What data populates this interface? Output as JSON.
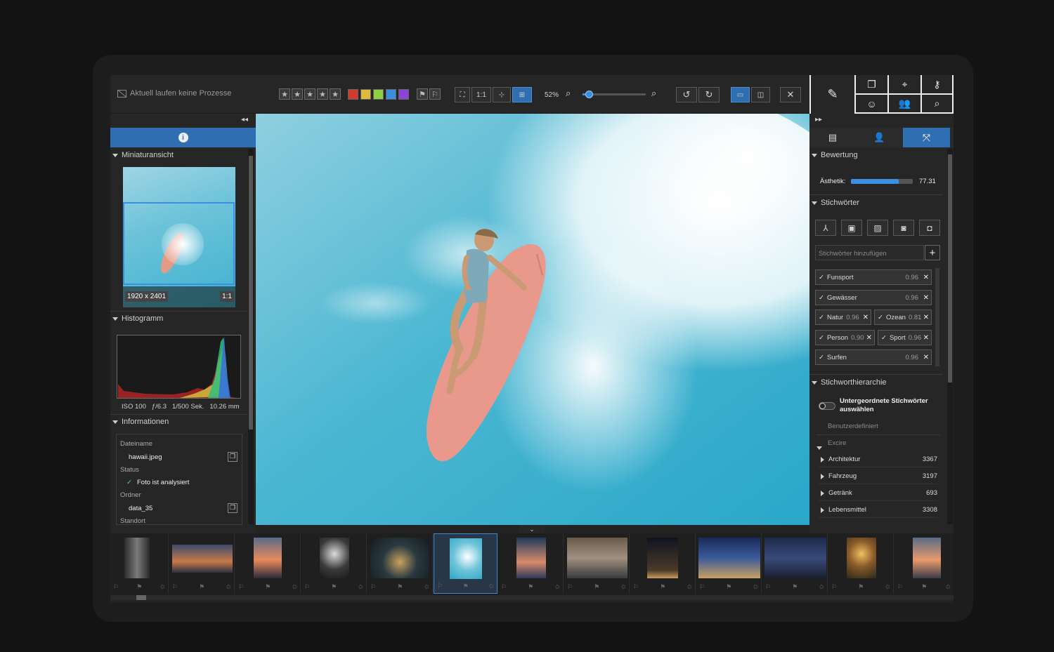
{
  "toolbar": {
    "status_text": "Aktuell laufen keine Prozesse",
    "zoom_label": "52%",
    "one_to_one": "1:1",
    "ratings": [
      "★",
      "★",
      "★",
      "★",
      "★"
    ],
    "color_labels": [
      "#d23b2c",
      "#e0b83a",
      "#8fd040",
      "#3a8fe0",
      "#8a44d8"
    ]
  },
  "left_panel": {
    "thumbnail_section": "Miniaturansicht",
    "dimensions": "1920 x 2401",
    "thumb_ratio": "1:1",
    "histogram_section": "Histogramm",
    "exif": {
      "iso": "ISO 100",
      "aperture": "ƒ/6.3",
      "shutter": "1/500 Sek.",
      "focal": "10.26 mm"
    },
    "info_section": "Informationen",
    "filename_label": "Dateiname",
    "filename": "hawaii.jpeg",
    "status_label": "Status",
    "status_value": "Foto ist analysiert",
    "folder_label": "Ordner",
    "folder_value": "data_35",
    "location_label": "Standort"
  },
  "right_panel": {
    "rating_section": "Bewertung",
    "aesthetic_label": "Ästhetik:",
    "aesthetic_value": "77.31",
    "aesthetic_fraction": 0.77,
    "keywords_section": "Stichwörter",
    "add_keyword_placeholder": "Stichwörter hinzufügen",
    "keywords": [
      {
        "name": "Funsport",
        "score": "0.96"
      },
      {
        "name": "Gewässer",
        "score": "0.96"
      },
      {
        "name": "Natur",
        "score": "0.96"
      },
      {
        "name": "Ozean",
        "score": "0.81"
      },
      {
        "name": "Person",
        "score": "0.90"
      },
      {
        "name": "Sport",
        "score": "0.96"
      },
      {
        "name": "Surfen",
        "score": "0.96"
      }
    ],
    "hierarchy_section": "Stichworthierarchie",
    "toggle_label": "Untergeordnete Stichwörter auswählen",
    "custom_label": "Benutzerdefiniert",
    "excire_label": "Excire",
    "tree": [
      {
        "name": "Architektur",
        "count": "3367"
      },
      {
        "name": "Fahrzeug",
        "count": "3197"
      },
      {
        "name": "Getränk",
        "count": "693"
      },
      {
        "name": "Lebensmittel",
        "count": "3308"
      }
    ]
  }
}
